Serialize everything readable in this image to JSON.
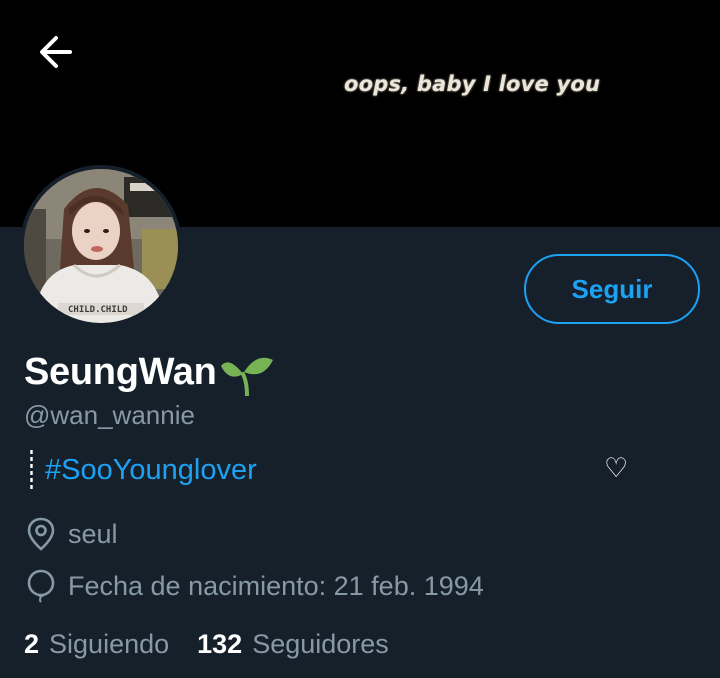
{
  "header": {
    "banner_text": "oops, baby I love you",
    "back_icon": "arrow-left-icon"
  },
  "profile": {
    "display_name": "SeungWan",
    "name_emoji": "seedling-icon",
    "handle": "@wan_wannie",
    "follow_label": "Seguir",
    "avatar_shirt_text": "CHILD.CHILD"
  },
  "bio": {
    "hashtag": "#SooYounglover",
    "heart": "♡"
  },
  "meta": {
    "location": "seul",
    "birthdate": "Fecha de nacimiento: 21 feb. 1994"
  },
  "stats": {
    "following_count": "2",
    "following_label": "Siguiendo",
    "followers_count": "132",
    "followers_label": "Seguidores"
  },
  "colors": {
    "background": "#15202b",
    "banner": "#000000",
    "accent": "#1da1f2",
    "secondary_text": "#8899a6"
  }
}
